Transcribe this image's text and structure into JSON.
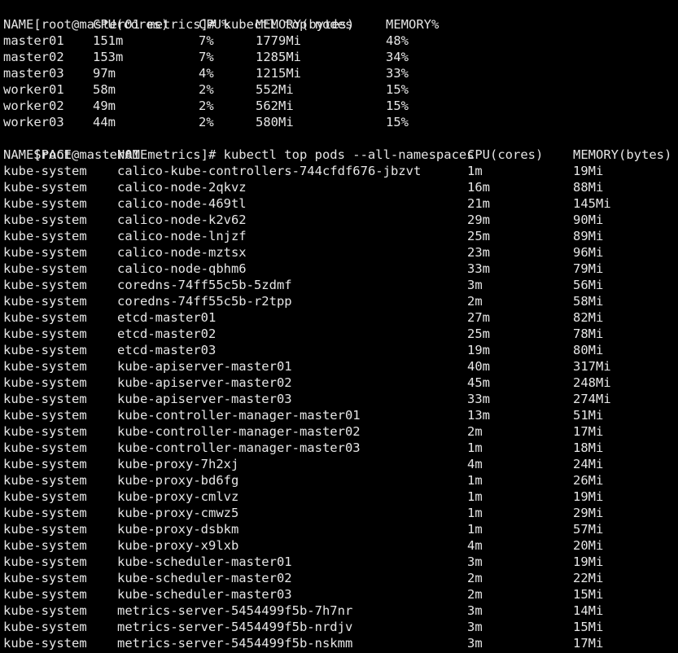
{
  "terminal": {
    "prompt": "[root@master01 metrics]# ",
    "commands": [
      "kubectl top nodes",
      "kubectl top pods --all-namespaces"
    ]
  },
  "nodes": {
    "headers": [
      "NAME",
      "CPU(cores)",
      "CPU%",
      "MEMORY(bytes)",
      "MEMORY%"
    ],
    "rows": [
      [
        "master01",
        "151m",
        "7%",
        "1779Mi",
        "48%"
      ],
      [
        "master02",
        "153m",
        "7%",
        "1285Mi",
        "34%"
      ],
      [
        "master03",
        "97m",
        "4%",
        "1215Mi",
        "33%"
      ],
      [
        "worker01",
        "58m",
        "2%",
        "552Mi",
        "15%"
      ],
      [
        "worker02",
        "49m",
        "2%",
        "562Mi",
        "15%"
      ],
      [
        "worker03",
        "44m",
        "2%",
        "580Mi",
        "15%"
      ]
    ]
  },
  "pods": {
    "headers": [
      "NAMESPACE",
      "NAME",
      "CPU(cores)",
      "MEMORY(bytes)"
    ],
    "rows": [
      [
        "kube-system",
        "calico-kube-controllers-744cfdf676-jbzvt",
        "1m",
        "19Mi"
      ],
      [
        "kube-system",
        "calico-node-2qkvz",
        "16m",
        "88Mi"
      ],
      [
        "kube-system",
        "calico-node-469tl",
        "21m",
        "145Mi"
      ],
      [
        "kube-system",
        "calico-node-k2v62",
        "29m",
        "90Mi"
      ],
      [
        "kube-system",
        "calico-node-lnjzf",
        "25m",
        "89Mi"
      ],
      [
        "kube-system",
        "calico-node-mztsx",
        "23m",
        "96Mi"
      ],
      [
        "kube-system",
        "calico-node-qbhm6",
        "33m",
        "79Mi"
      ],
      [
        "kube-system",
        "coredns-74ff55c5b-5zdmf",
        "3m",
        "56Mi"
      ],
      [
        "kube-system",
        "coredns-74ff55c5b-r2tpp",
        "2m",
        "58Mi"
      ],
      [
        "kube-system",
        "etcd-master01",
        "27m",
        "82Mi"
      ],
      [
        "kube-system",
        "etcd-master02",
        "25m",
        "78Mi"
      ],
      [
        "kube-system",
        "etcd-master03",
        "19m",
        "80Mi"
      ],
      [
        "kube-system",
        "kube-apiserver-master01",
        "40m",
        "317Mi"
      ],
      [
        "kube-system",
        "kube-apiserver-master02",
        "45m",
        "248Mi"
      ],
      [
        "kube-system",
        "kube-apiserver-master03",
        "33m",
        "274Mi"
      ],
      [
        "kube-system",
        "kube-controller-manager-master01",
        "13m",
        "51Mi"
      ],
      [
        "kube-system",
        "kube-controller-manager-master02",
        "2m",
        "17Mi"
      ],
      [
        "kube-system",
        "kube-controller-manager-master03",
        "1m",
        "18Mi"
      ],
      [
        "kube-system",
        "kube-proxy-7h2xj",
        "4m",
        "24Mi"
      ],
      [
        "kube-system",
        "kube-proxy-bd6fg",
        "1m",
        "26Mi"
      ],
      [
        "kube-system",
        "kube-proxy-cmlvz",
        "1m",
        "19Mi"
      ],
      [
        "kube-system",
        "kube-proxy-cmwz5",
        "1m",
        "29Mi"
      ],
      [
        "kube-system",
        "kube-proxy-dsbkm",
        "1m",
        "57Mi"
      ],
      [
        "kube-system",
        "kube-proxy-x9lxb",
        "4m",
        "20Mi"
      ],
      [
        "kube-system",
        "kube-scheduler-master01",
        "3m",
        "19Mi"
      ],
      [
        "kube-system",
        "kube-scheduler-master02",
        "2m",
        "22Mi"
      ],
      [
        "kube-system",
        "kube-scheduler-master03",
        "2m",
        "15Mi"
      ],
      [
        "kube-system",
        "metrics-server-5454499f5b-7h7nr",
        "3m",
        "14Mi"
      ],
      [
        "kube-system",
        "metrics-server-5454499f5b-nrdjv",
        "3m",
        "15Mi"
      ],
      [
        "kube-system",
        "metrics-server-5454499f5b-nskmm",
        "3m",
        "17Mi"
      ]
    ]
  },
  "colors": {
    "background": "#000000",
    "foreground": "#e6e6e6"
  }
}
